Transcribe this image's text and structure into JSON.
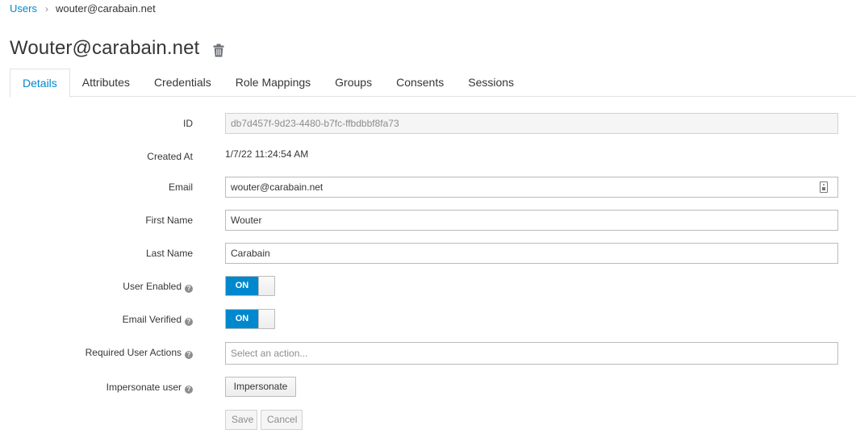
{
  "breadcrumb": {
    "parent": "Users",
    "separator": "›",
    "current": "wouter@carabain.net"
  },
  "page": {
    "title": "Wouter@carabain.net"
  },
  "tabs": [
    {
      "label": "Details"
    },
    {
      "label": "Attributes"
    },
    {
      "label": "Credentials"
    },
    {
      "label": "Role Mappings"
    },
    {
      "label": "Groups"
    },
    {
      "label": "Consents"
    },
    {
      "label": "Sessions"
    }
  ],
  "form": {
    "id": {
      "label": "ID",
      "value": "db7d457f-9d23-4480-b7fc-ffbdbbf8fa73"
    },
    "created_at": {
      "label": "Created At",
      "value": "1/7/22 11:24:54 AM"
    },
    "email": {
      "label": "Email",
      "value": "wouter@carabain.net"
    },
    "first_name": {
      "label": "First Name",
      "value": "Wouter"
    },
    "last_name": {
      "label": "Last Name",
      "value": "Carabain"
    },
    "user_enabled": {
      "label": "User Enabled",
      "state": "ON"
    },
    "email_verified": {
      "label": "Email Verified",
      "state": "ON"
    },
    "required_actions": {
      "label": "Required User Actions",
      "placeholder": "Select an action..."
    },
    "impersonate": {
      "label": "Impersonate user",
      "button": "Impersonate"
    }
  },
  "actions": {
    "save": "Save",
    "cancel": "Cancel"
  },
  "colors": {
    "accent": "#0088ce",
    "text": "#363636",
    "border": "#bbbbbb"
  }
}
